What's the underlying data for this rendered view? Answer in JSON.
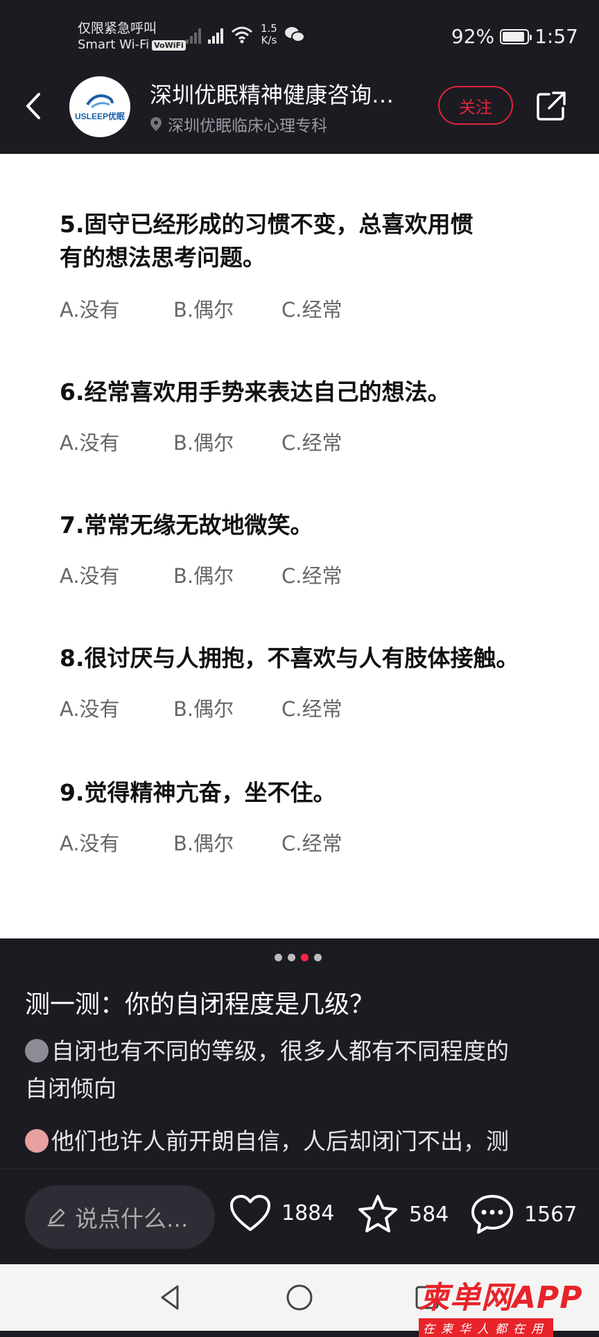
{
  "status_bar": {
    "carrier_line1": "仅限紧急呼叫",
    "carrier_line2": "Smart Wi-Fi",
    "volte": "VoWiFi",
    "speed_value": "1.5",
    "speed_unit": "K/s",
    "battery": "92%",
    "battery_level": 0.92,
    "time": "1:57"
  },
  "header": {
    "logo_text": "USLEEP优眠",
    "title": "深圳优眠精神健康咨询…",
    "location": "深圳优眠临床心理专科",
    "follow_label": "关注"
  },
  "questions": [
    {
      "lines": [
        "5.固守已经形成的习惯不变，总喜欢用惯",
        "有的想法思考问题。"
      ],
      "options": [
        "A.没有",
        "B.偶尔",
        "C.经常"
      ]
    },
    {
      "lines": [
        "6.经常喜欢用手势来表达自己的想法。"
      ],
      "options": [
        "A.没有",
        "B.偶尔",
        "C.经常"
      ]
    },
    {
      "lines": [
        "7.常常无缘无故地微笑。"
      ],
      "options": [
        "A.没有",
        "B.偶尔",
        "C.经常"
      ]
    },
    {
      "lines": [
        "8.很讨厌与人拥抱，不喜欢与人有肢体接触。"
      ],
      "options": [
        "A.没有",
        "B.偶尔",
        "C.经常"
      ]
    },
    {
      "lines": [
        "9.觉得精神亢奋，坐不住。"
      ],
      "options": [
        "A.没有",
        "B.偶尔",
        "C.经常"
      ]
    }
  ],
  "carousel": {
    "total": 4,
    "active_index": 2
  },
  "post": {
    "title": "测一测：你的自闭程度是几级？",
    "para1_line1": "自闭也有不同的等级，很多人都有不同程度的",
    "para1_line2": "自闭倾向",
    "para2_line1": "他们也许人前开朗自信，人后却闭门不出，测",
    "emoji1": "ghost-emoji",
    "emoji2": "pig-emoji"
  },
  "bottom_bar": {
    "comment_placeholder": "说点什么...",
    "likes": "1884",
    "favorites": "584",
    "comments": "1567"
  },
  "watermark": {
    "main": "柬单网APP",
    "sub": "在柬华人都在用"
  },
  "colors": {
    "accent": "#ff2442",
    "follow": "#e0243a",
    "background": "#1c1b22",
    "card": "#ffffff"
  }
}
